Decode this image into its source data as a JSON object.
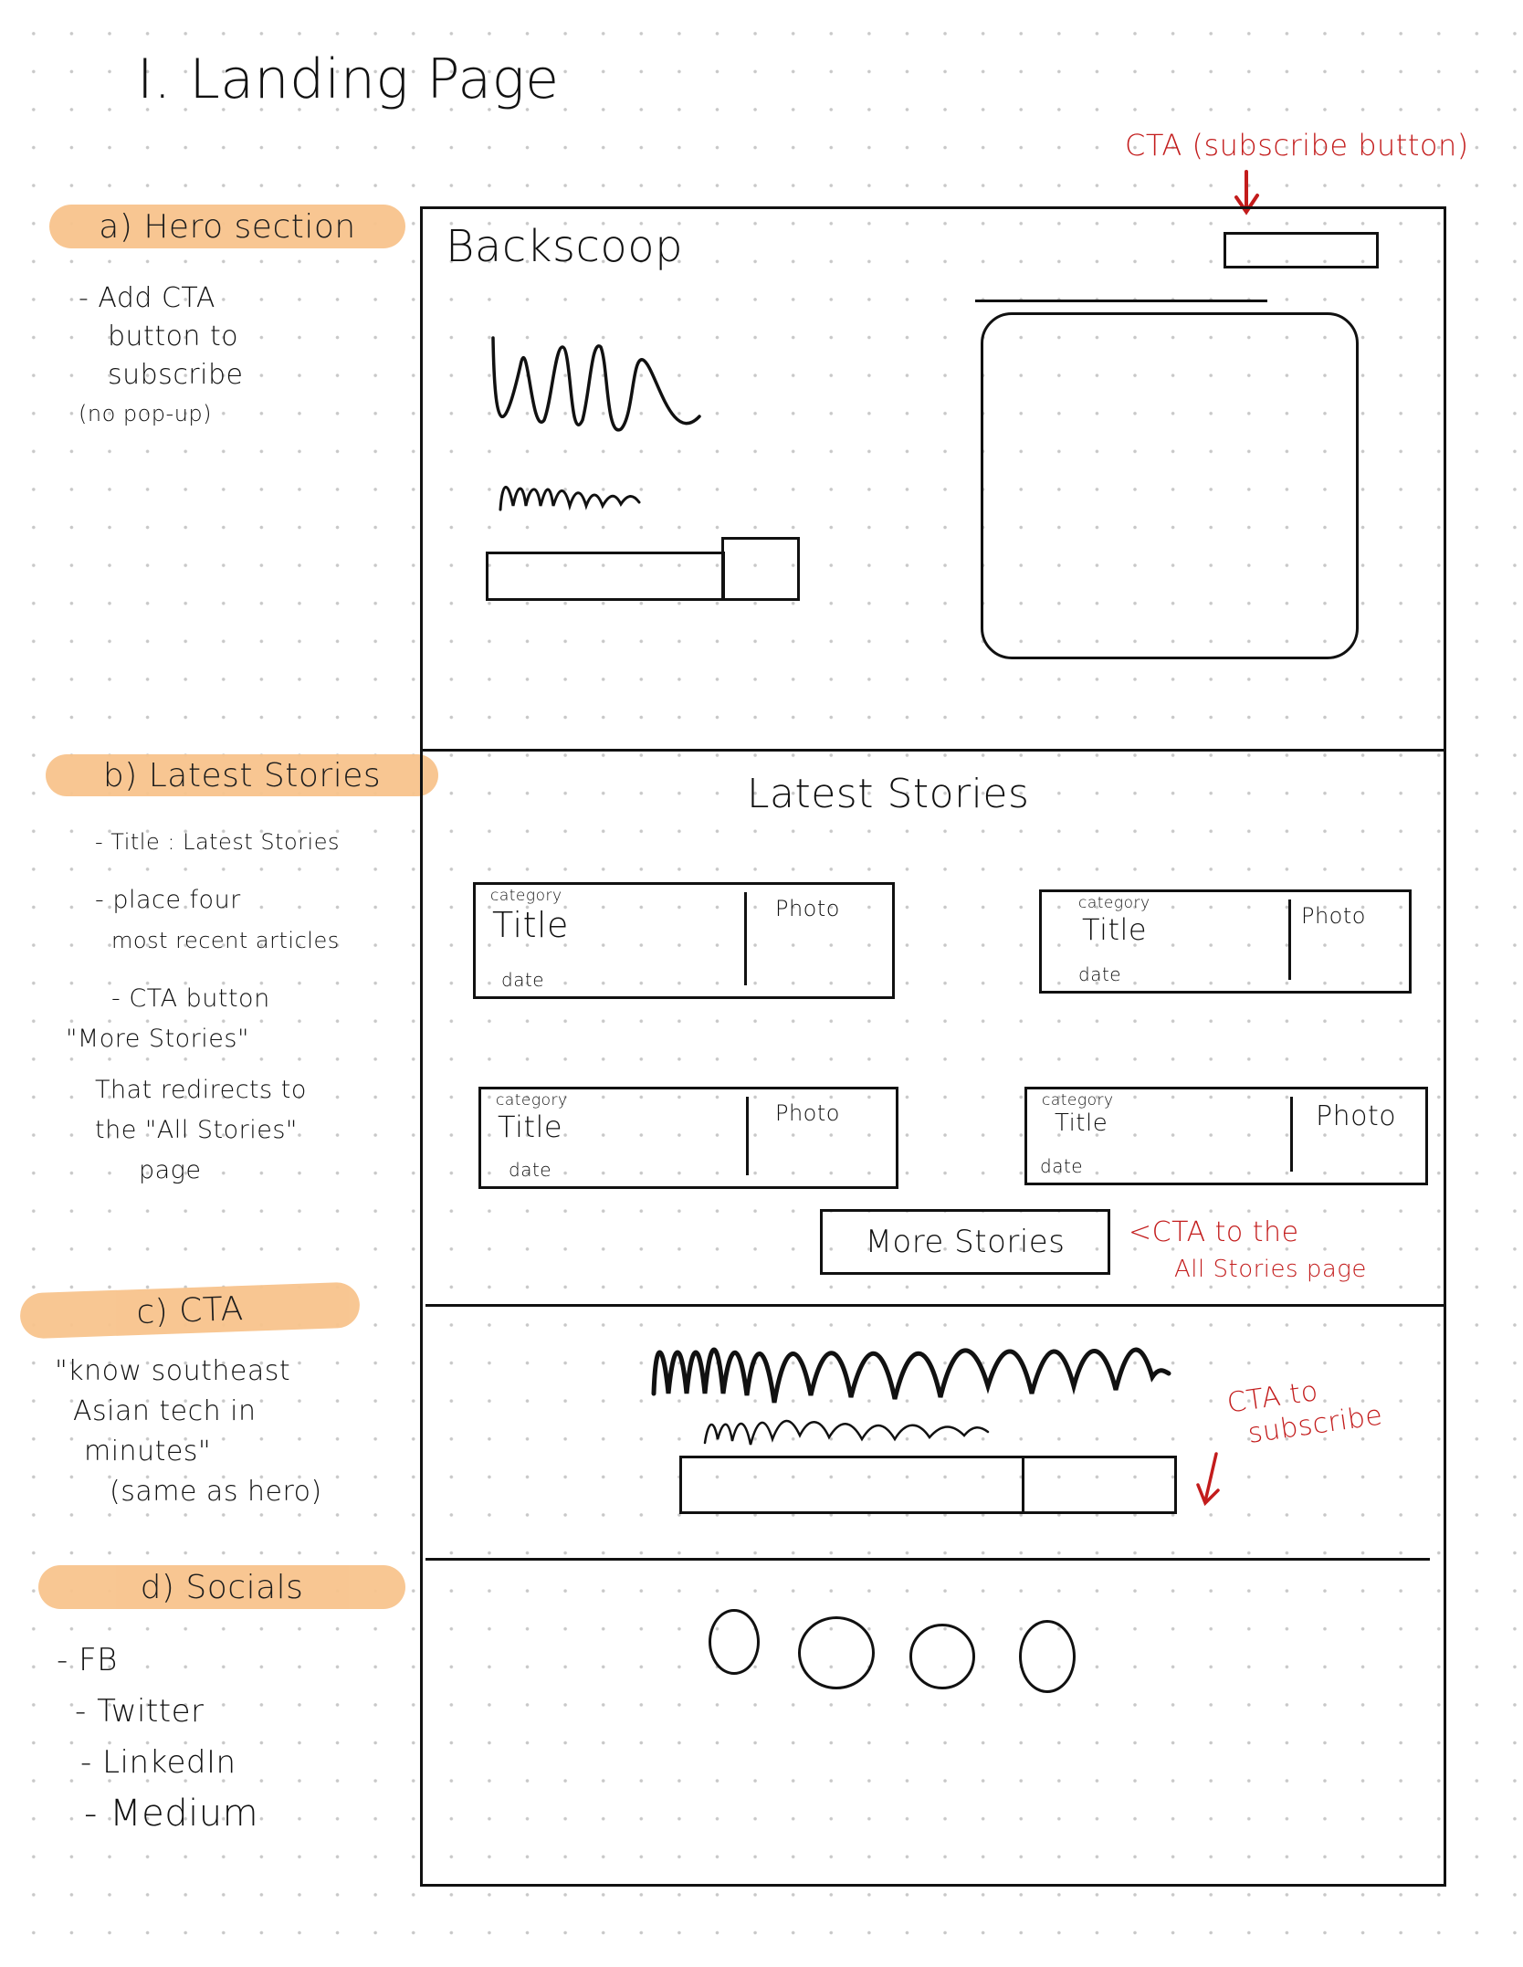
{
  "page_title": "I. Landing Page",
  "annotations": {
    "hero_cta": "CTA (subscribe button)",
    "more_stories_cta": [
      "<CTA to the",
      "All Stories page"
    ],
    "subscribe_cta": [
      "CTA to",
      "subscribe"
    ]
  },
  "notes": {
    "hero": {
      "heading": "a) Hero section",
      "lines": [
        "- Add CTA",
        "button to",
        "subscribe",
        "(no pop-up)"
      ]
    },
    "latest": {
      "heading": "b) Latest Stories",
      "lines": [
        "- Title : Latest Stories",
        "- place four",
        "most recent articles",
        "- CTA button",
        "\"More Stories\"",
        "That redirects to",
        "the \"All Stories\"",
        "page"
      ]
    },
    "cta": {
      "heading": "c) CTA",
      "lines": [
        "\"know southeast",
        "Asian tech in",
        "minutes\"",
        "(same as hero)"
      ]
    },
    "socials": {
      "heading": "d) Socials",
      "lines": [
        "- FB",
        "- Twitter",
        "- LinkedIn",
        "- Medium"
      ]
    }
  },
  "wireframe": {
    "logo": "Backscoop",
    "latest_title": "Latest Stories",
    "cards": [
      {
        "category": "category",
        "title": "Title",
        "date": "date",
        "photo": "Photo"
      },
      {
        "category": "category",
        "title": "Title",
        "date": "date",
        "photo": "Photo"
      },
      {
        "category": "category",
        "title": "Title",
        "date": "date",
        "photo": "Photo"
      },
      {
        "category": "category",
        "title": "Title",
        "date": "date",
        "photo": "Photo"
      }
    ],
    "more_stories_label": "More Stories",
    "social_icons": [
      "facebook-icon",
      "twitter-icon",
      "linkedin-icon",
      "medium-icon"
    ]
  },
  "colors": {
    "highlight": "#f8c48d",
    "annotation_red": "#c31c1c",
    "ink": "#111111"
  }
}
